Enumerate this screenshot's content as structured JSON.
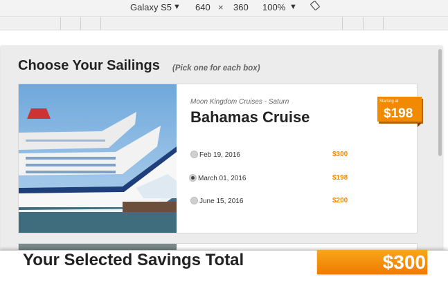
{
  "devtools": {
    "device": "Galaxy S5",
    "width": "640",
    "times": "×",
    "height": "360",
    "zoom": "100%",
    "dropdown_arrow": "▼",
    "rotate_icon": "rotate-icon"
  },
  "page": {
    "title": "Choose Your Sailings",
    "subtitle": "(Pick one for each box)",
    "cruise": {
      "operator": "Moon Kingdom Cruises - Saturn",
      "name": "Bahamas Cruise",
      "badge_label": "Starting at",
      "badge_price": "$198",
      "sailings": [
        {
          "date": "Feb 19, 2016",
          "price": "$300",
          "selected": false
        },
        {
          "date": "March 01, 2016",
          "price": "$198",
          "selected": true
        },
        {
          "date": "June 15, 2016",
          "price": "$200",
          "selected": false
        }
      ]
    },
    "footer": {
      "label": "Your Selected Savings Total",
      "total": "$300"
    }
  },
  "colors": {
    "accent": "#f28a00",
    "panel": "#ececec"
  }
}
